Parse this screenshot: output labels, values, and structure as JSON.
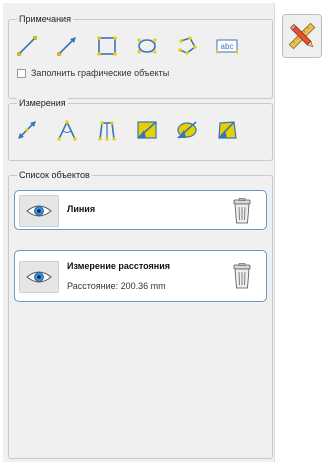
{
  "annotations": {
    "title": "Примечания",
    "tools": [
      {
        "icon": "line-tool-icon"
      },
      {
        "icon": "arrow-line-tool-icon"
      },
      {
        "icon": "rectangle-tool-icon"
      },
      {
        "icon": "ellipse-tool-icon"
      },
      {
        "icon": "polygon-tool-icon"
      },
      {
        "icon": "text-tool-icon",
        "text": "abc"
      }
    ],
    "fill_label": "Заполнить графические объекты",
    "fill_checked": false
  },
  "measurements": {
    "title": "Измерения",
    "tools": [
      {
        "icon": "distance-tool-icon"
      },
      {
        "icon": "angle-tool-icon"
      },
      {
        "icon": "perimeter-tool-icon"
      },
      {
        "icon": "area-rectangle-tool-icon"
      },
      {
        "icon": "area-ellipse-tool-icon"
      },
      {
        "icon": "area-polygon-tool-icon"
      }
    ]
  },
  "object_list": {
    "title": "Список объектов",
    "items": [
      {
        "name": "Линия",
        "detail": ""
      },
      {
        "name": "Измерение расстояния",
        "detail": "Расстояние: 200.36 mm"
      }
    ]
  },
  "colors": {
    "accent_blue": "#6f96c8",
    "tool_yellow": "#e8d000",
    "tool_blue": "#3b73b9"
  }
}
